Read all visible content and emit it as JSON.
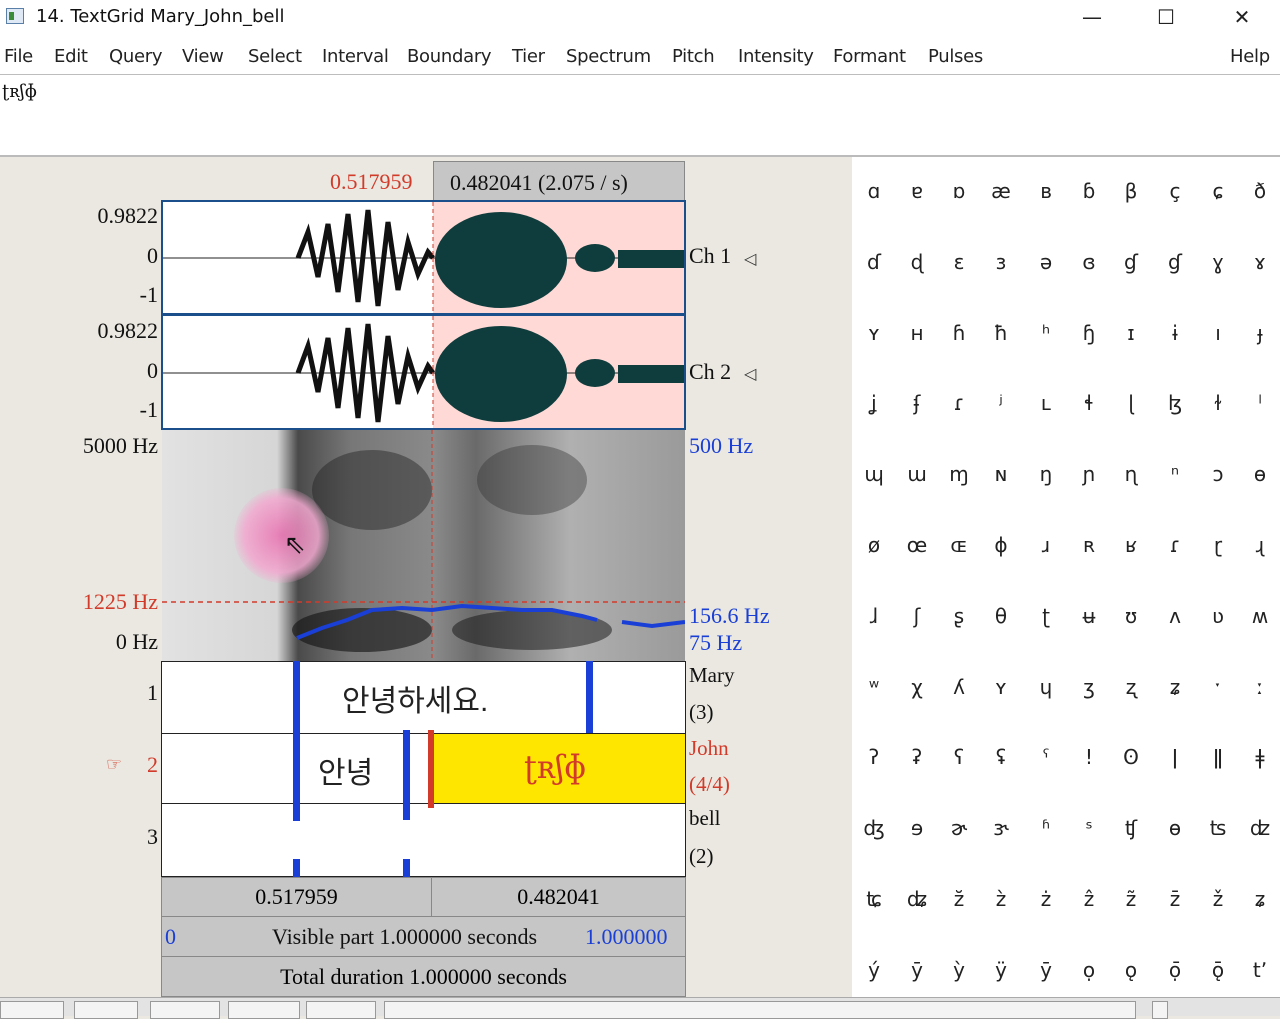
{
  "window": {
    "title": "14. TextGrid Mary_John_bell"
  },
  "menu": [
    "File",
    "Edit",
    "Query",
    "View",
    "Select",
    "Interval",
    "Boundary",
    "Tier",
    "Spectrum",
    "Pitch",
    "Intensity",
    "Formant",
    "Pulses"
  ],
  "help": "Help",
  "text_field": {
    "value": "ʈʀʃɸ"
  },
  "editor": {
    "sel_start": "0.517959",
    "sel_length": "0.482041 (2.075 / s)",
    "ch1": {
      "max": "0.9822",
      "zero": "0",
      "min": "-1",
      "label": "Ch 1"
    },
    "ch2": {
      "max": "0.9822",
      "zero": "0",
      "min": "-1",
      "label": "Ch 2"
    },
    "spec": {
      "top": "5000 Hz",
      "cursor": "1225 Hz",
      "bottom": "0 Hz",
      "pitch_top": "500 Hz",
      "pitch_val": "156.6 Hz",
      "pitch_bottom": "75 Hz"
    },
    "tiers": [
      {
        "num": "1",
        "name": "Mary",
        "count": "(3)",
        "text": "안녕하세요."
      },
      {
        "num": "2",
        "name": "John",
        "count": "(4/4)",
        "text1": "안녕",
        "text2": "ʈʀʃɸ"
      },
      {
        "num": "3",
        "name": "bell",
        "count": "(2)"
      }
    ],
    "bottom": {
      "left_dur": "0.517959",
      "right_dur": "0.482041",
      "vis_start": "0",
      "visible": "Visible part 1.000000 seconds",
      "vis_end": "1.000000",
      "total": "Total duration 1.000000 seconds"
    }
  },
  "palette": [
    [
      "ɑ",
      "ɐ",
      "ɒ",
      "æ",
      "ʙ",
      "ɓ",
      "β",
      "ç",
      "ɕ",
      "ð"
    ],
    [
      "ɗ",
      "ɖ",
      "ɛ",
      "ɜ",
      "ə",
      "ɞ",
      "ɠ",
      "ɠ",
      "ɣ",
      "ɤ"
    ],
    [
      "ʏ",
      "ʜ",
      "ɦ",
      "ħ",
      "ʰ",
      "ɧ",
      "ɪ",
      "ɨ",
      "ı",
      "ɟ"
    ],
    [
      "ʝ",
      "ʄ",
      "ɾ",
      "ʲ",
      "ʟ",
      "ɬ",
      "ɭ",
      "ɮ",
      "ɫ",
      "ˡ"
    ],
    [
      "ɰ",
      "ɯ",
      "ɱ",
      "ɴ",
      "ŋ",
      "ɲ",
      "ɳ",
      "ⁿ",
      "ɔ",
      "ɵ"
    ],
    [
      "ø",
      "œ",
      "ɶ",
      "ɸ",
      "ɹ",
      "ʀ",
      "ʁ",
      "ɾ",
      "ɽ",
      "ɻ"
    ],
    [
      "ɺ",
      "ʃ",
      "ʂ",
      "θ",
      "ʈ",
      "ʉ",
      "ʊ",
      "ʌ",
      "ʋ",
      "ʍ"
    ],
    [
      "ʷ",
      "χ",
      "ʎ",
      "ʏ",
      "ɥ",
      "ʒ",
      "ʐ",
      "ʑ",
      "ˑ",
      "ː"
    ],
    [
      "ʔ",
      "ʡ",
      "ʕ",
      "ʢ",
      "ˤ",
      "ǃ",
      "ʘ",
      "ǀ",
      "ǁ",
      "ǂ"
    ],
    [
      "ʤ",
      "ɘ",
      "ɚ",
      "ɝ",
      "ʱ",
      "ˢ",
      "ʧ",
      "ɵ",
      "ʦ",
      "ʣ"
    ],
    [
      "ʨ",
      "ʥ",
      "z̆",
      "z̀",
      "ż",
      "ẑ",
      "z̃",
      "z̄",
      "ž",
      "ʑ"
    ],
    [
      "ý",
      "ȳ",
      "ỳ",
      "ÿ",
      "ȳ",
      "ọ",
      "ǫ",
      "ọ̄",
      "ǭ",
      "tʼ"
    ]
  ]
}
